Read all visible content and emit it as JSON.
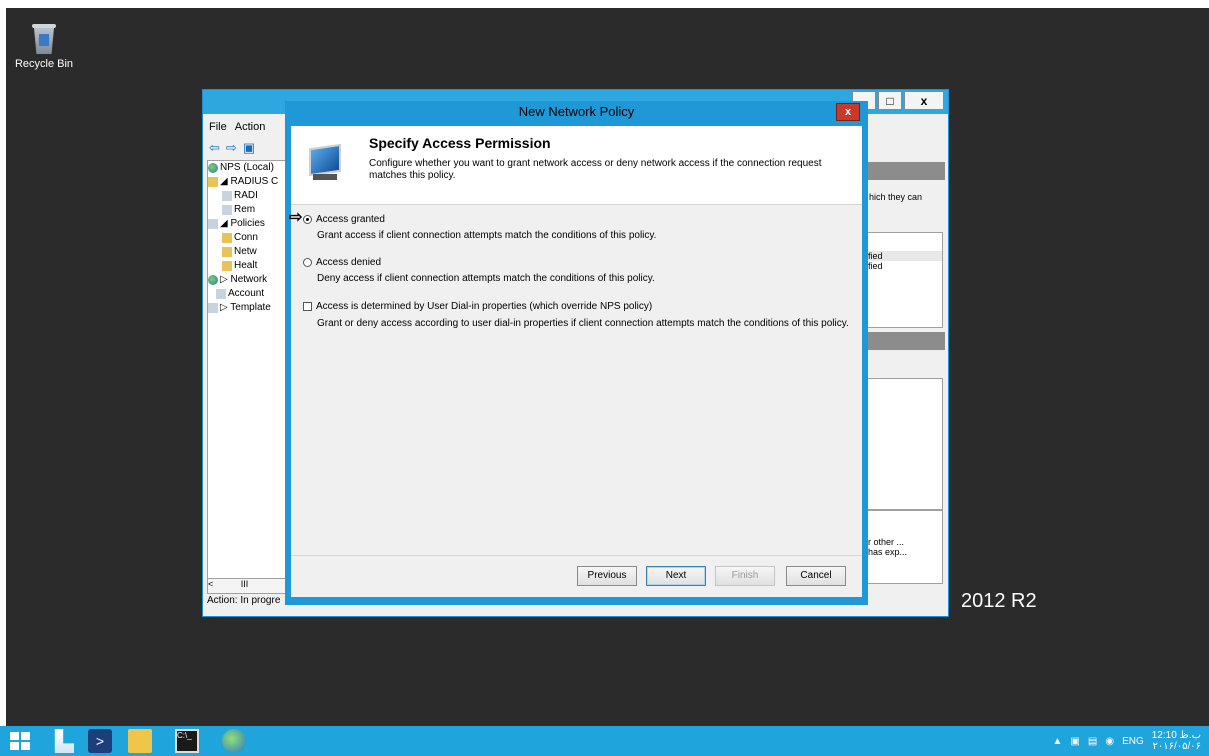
{
  "desktop": {
    "recycle_bin_label": "Recycle Bin",
    "watermark": "2012 R2"
  },
  "mmc": {
    "menu": [
      "File",
      "Action"
    ],
    "tree": [
      {
        "label": "NPS (Local)",
        "icon": "globe"
      },
      {
        "label": "◢ RADIUS C",
        "icon": "folder"
      },
      {
        "label": "RADI",
        "icon": "doc"
      },
      {
        "label": "Rem",
        "icon": "doc"
      },
      {
        "label": "◢ Policies",
        "icon": "doc"
      },
      {
        "label": "Conn",
        "icon": "folder"
      },
      {
        "label": "Netw",
        "icon": "folder"
      },
      {
        "label": "Healt",
        "icon": "folder"
      },
      {
        "label": "▷ Network",
        "icon": "globe"
      },
      {
        "label": "Account",
        "icon": "doc"
      },
      {
        "label": "▷ Template",
        "icon": "doc"
      }
    ],
    "status": "Action: In progre",
    "right": {
      "text1": "hich they can",
      "text2": "fied",
      "text3": "fied",
      "text4": "r other ...",
      "text5": "has exp..."
    }
  },
  "wizard": {
    "title": "New Network Policy",
    "close_label": "x",
    "heading": "Specify Access Permission",
    "description": "Configure whether you want to grant network access or deny network access if the connection request matches this policy.",
    "options": {
      "granted_label": "Access granted",
      "granted_desc": "Grant access if client connection attempts match the conditions of this policy.",
      "denied_label": "Access denied",
      "denied_desc": "Deny access if client connection attempts match the conditions of this policy.",
      "dialin_label": "Access is determined by User Dial-in properties (which override NPS policy)",
      "dialin_desc": "Grant or deny access according to user dial-in properties if client connection attempts match the conditions of this policy."
    },
    "buttons": {
      "previous": "Previous",
      "next": "Next",
      "finish": "Finish",
      "cancel": "Cancel"
    }
  },
  "taskbar": {
    "language": "ENG",
    "time": "12:10 ب.ظ",
    "date": "۲۰۱۶/۰۵/۰۶"
  }
}
